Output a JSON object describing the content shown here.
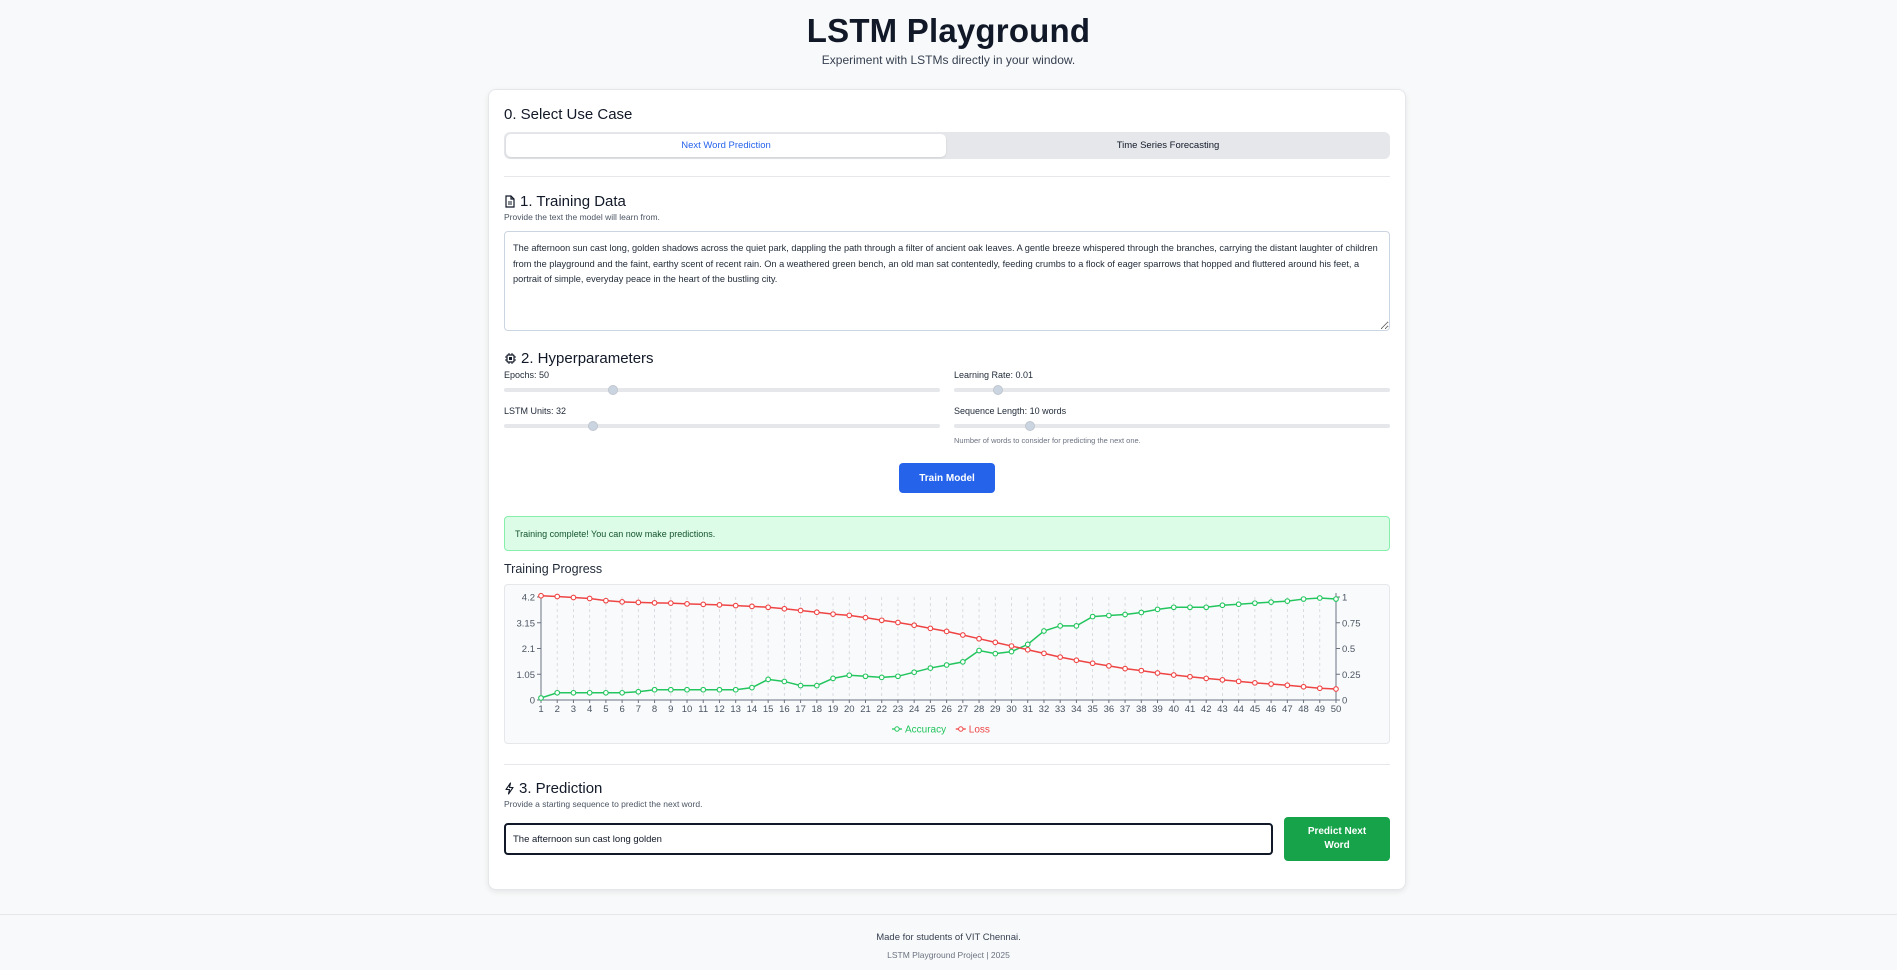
{
  "header": {
    "title": "LSTM Playground",
    "subtitle": "Experiment with LSTMs directly in your window."
  },
  "use_case": {
    "title": "0. Select Use Case",
    "tabs": [
      {
        "label": "Next Word Prediction",
        "active": true
      },
      {
        "label": "Time Series Forecasting",
        "active": false
      }
    ]
  },
  "training_data": {
    "title": "1. Training Data",
    "icon": "document-icon",
    "description": "Provide the text the model will learn from.",
    "text": "The afternoon sun cast long, golden shadows across the quiet park, dappling the path through a filter of ancient oak leaves. A gentle breeze whispered through the branches, carrying the distant laughter of children from the playground and the faint, earthy scent of recent rain. On a weathered green bench, an old man sat contentedly, feeding crumbs to a flock of eager sparrows that hopped and fluttered around his feet, a portrait of simple, everyday peace in the heart of the bustling city."
  },
  "hyperparameters": {
    "title": "2. Hyperparameters",
    "icon": "cpu-icon",
    "epochs": {
      "label": "Epochs: 50",
      "fraction": 0.25
    },
    "learning_rate": {
      "label": "Learning Rate: 0.01",
      "fraction": 0.1
    },
    "lstm_units": {
      "label": "LSTM Units: 32",
      "fraction": 0.205
    },
    "sequence_length": {
      "label": "Sequence Length: 10 words",
      "fraction": 0.175,
      "help": "Number of words to consider for predicting the next one."
    }
  },
  "train_button": "Train Model",
  "status": "Training complete! You can now make predictions.",
  "progress_title": "Training Progress",
  "chart_data": {
    "type": "line",
    "x": [
      1,
      2,
      3,
      4,
      5,
      6,
      7,
      8,
      9,
      10,
      11,
      12,
      13,
      14,
      15,
      16,
      17,
      18,
      19,
      20,
      21,
      22,
      23,
      24,
      25,
      26,
      27,
      28,
      29,
      30,
      31,
      32,
      33,
      34,
      35,
      36,
      37,
      38,
      39,
      40,
      41,
      42,
      43,
      44,
      45,
      46,
      47,
      48,
      49,
      50
    ],
    "series": [
      {
        "name": "Accuracy",
        "axis": "right",
        "color": "#22c55e",
        "values": [
          0.02,
          0.07,
          0.07,
          0.07,
          0.07,
          0.07,
          0.08,
          0.1,
          0.1,
          0.1,
          0.1,
          0.1,
          0.1,
          0.12,
          0.2,
          0.18,
          0.14,
          0.14,
          0.21,
          0.24,
          0.23,
          0.22,
          0.23,
          0.27,
          0.31,
          0.34,
          0.37,
          0.48,
          0.45,
          0.47,
          0.54,
          0.67,
          0.72,
          0.72,
          0.81,
          0.82,
          0.83,
          0.85,
          0.88,
          0.9,
          0.9,
          0.9,
          0.92,
          0.93,
          0.94,
          0.95,
          0.96,
          0.98,
          0.99,
          0.98
        ]
      },
      {
        "name": "Loss",
        "axis": "left",
        "color": "#ef4444",
        "values": [
          4.25,
          4.22,
          4.18,
          4.14,
          4.05,
          4.0,
          3.98,
          3.96,
          3.95,
          3.92,
          3.9,
          3.88,
          3.85,
          3.82,
          3.78,
          3.72,
          3.65,
          3.58,
          3.5,
          3.45,
          3.36,
          3.25,
          3.16,
          3.05,
          2.92,
          2.8,
          2.65,
          2.5,
          2.35,
          2.2,
          2.05,
          1.9,
          1.75,
          1.62,
          1.5,
          1.39,
          1.28,
          1.2,
          1.1,
          1.02,
          0.95,
          0.88,
          0.82,
          0.76,
          0.7,
          0.65,
          0.6,
          0.54,
          0.48,
          0.45
        ]
      }
    ],
    "left_ticks": [
      "0",
      "1.05",
      "2.1",
      "3.15",
      "4.2"
    ],
    "left_ylim": [
      0,
      4.2
    ],
    "right_ticks": [
      "0",
      "0.25",
      "0.5",
      "0.75",
      "1"
    ],
    "right_ylim": [
      0,
      1
    ],
    "grid": "vertical dashed",
    "legend": "bottom-center"
  },
  "prediction": {
    "title": "3. Prediction",
    "icon": "lightning-icon",
    "description": "Provide a starting sequence to predict the next word.",
    "input_value": "The afternoon sun cast long golden",
    "button": "Predict Next Word"
  },
  "footer": {
    "main": "Made for students of VIT Chennai.",
    "sub": "LSTM Playground Project | 2025"
  }
}
